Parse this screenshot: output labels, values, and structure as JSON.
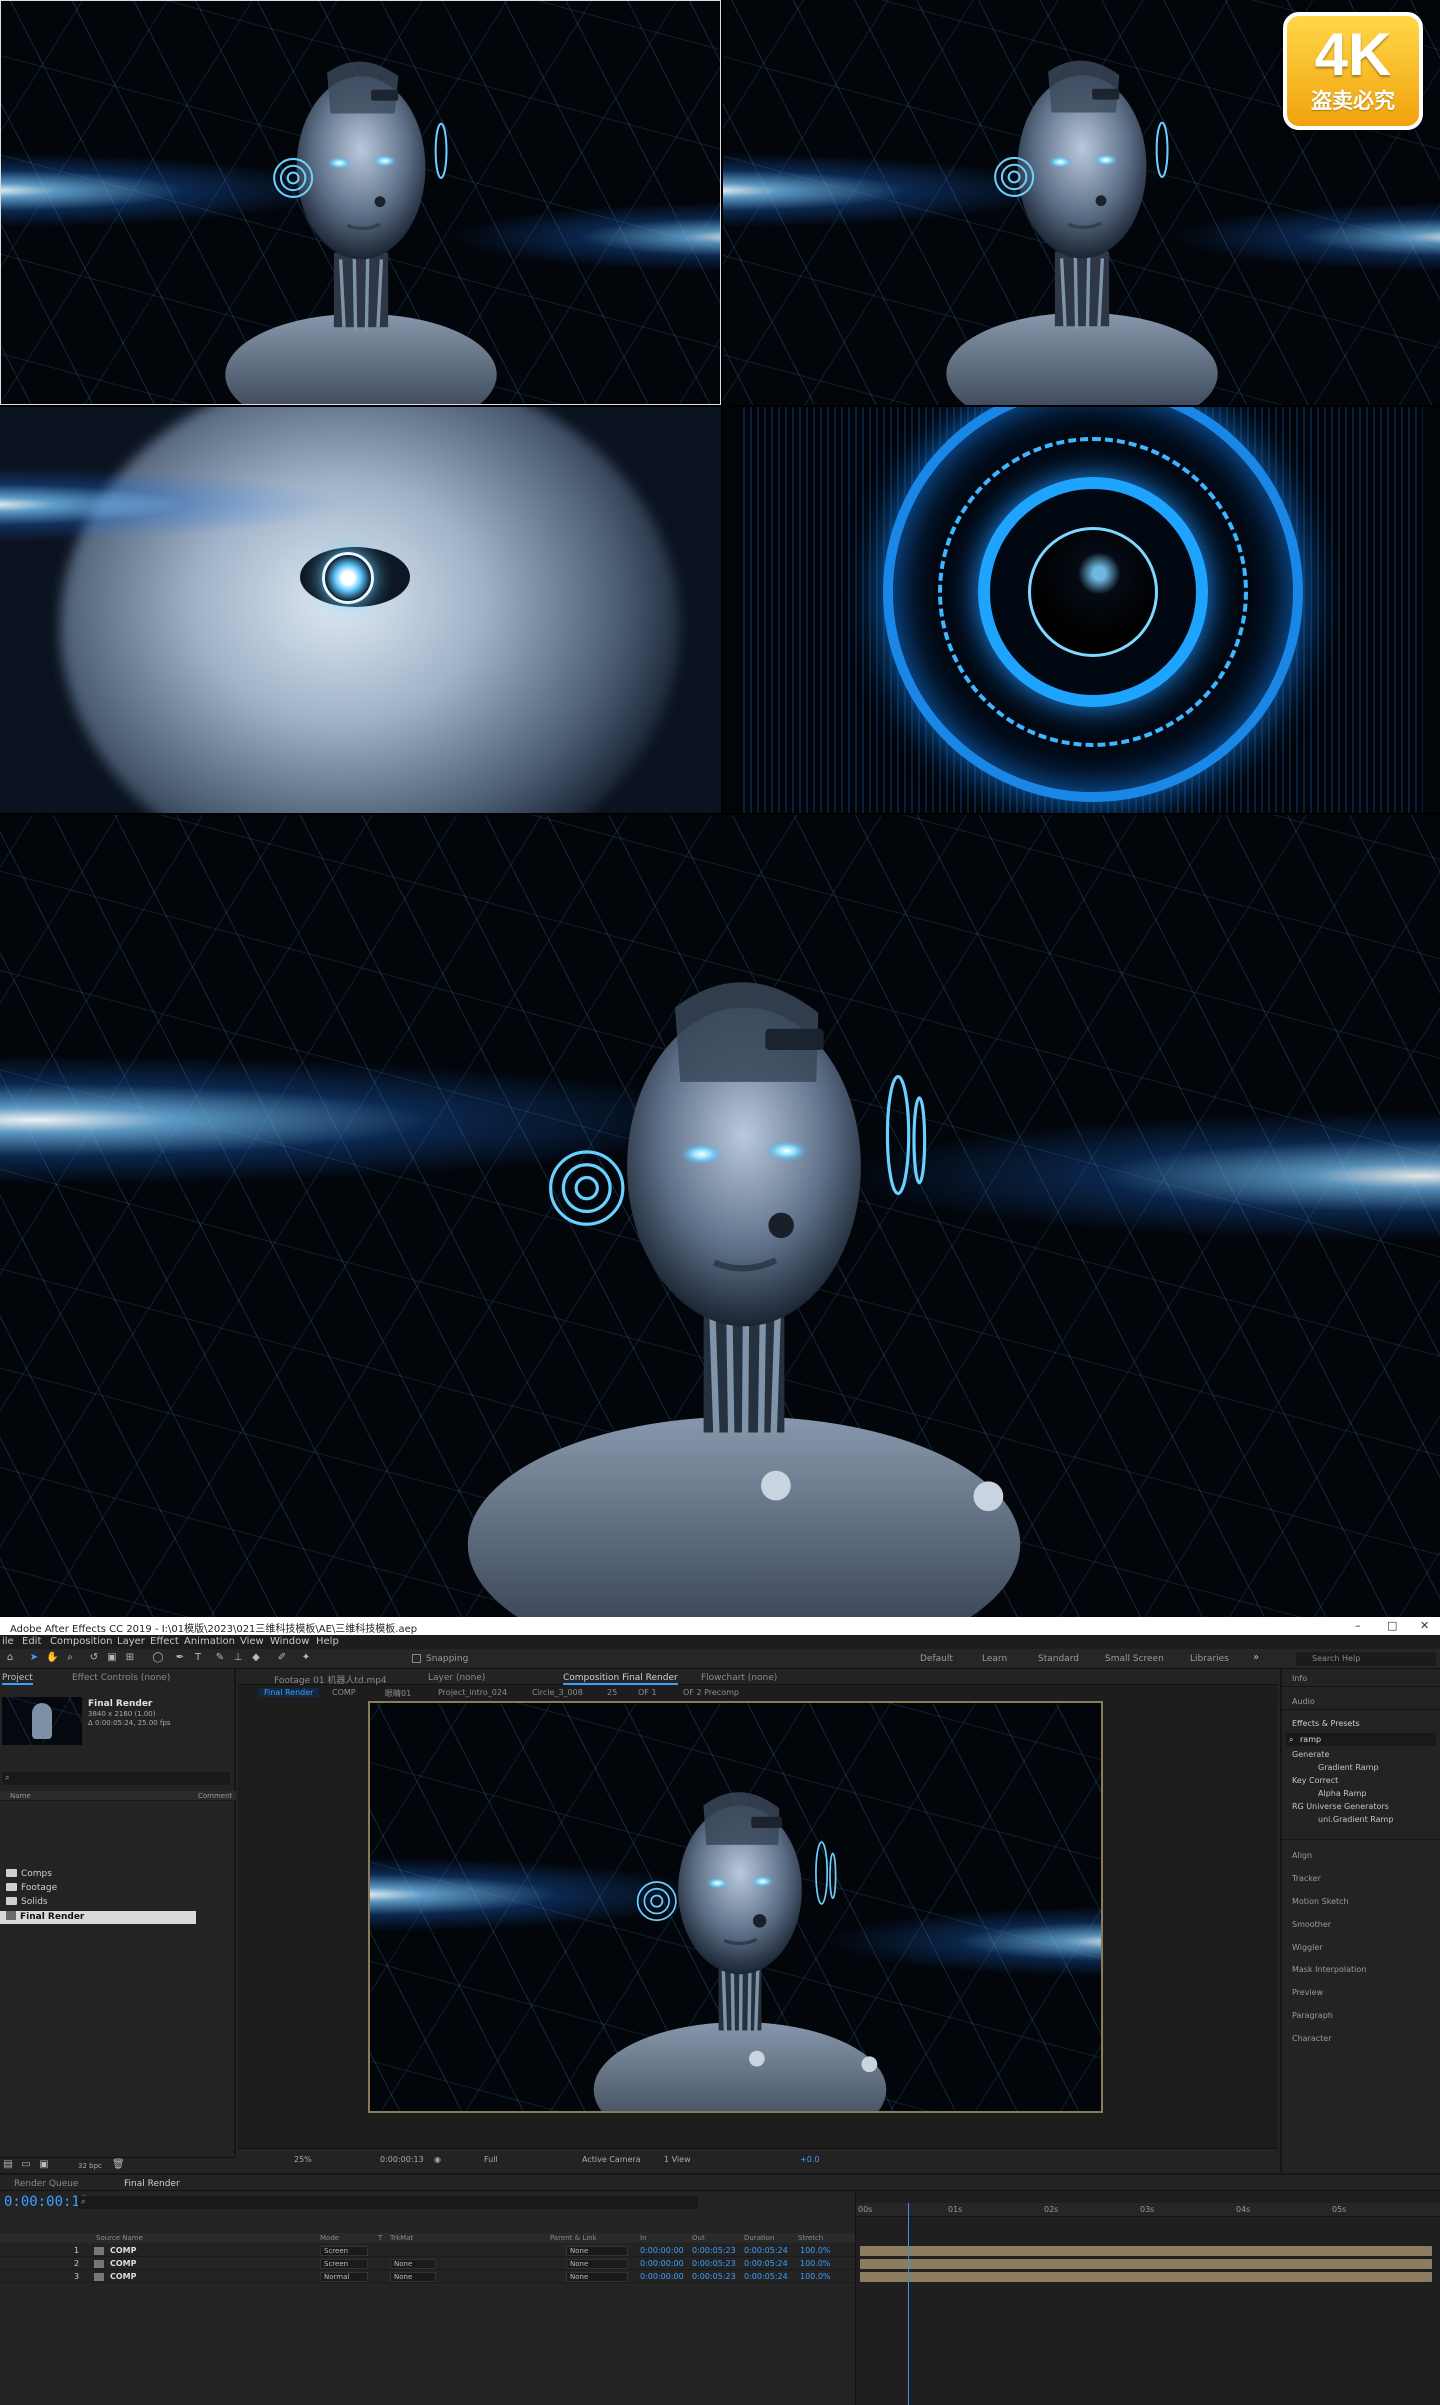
{
  "badge": {
    "big": "4K",
    "small": "盗卖必究"
  },
  "window": {
    "title": "Adobe After Effects CC 2019 - I:\\01模版\\2023\\021三维科技模板\\AE\\三维科技模板.aep",
    "controls": [
      "–",
      "□",
      "✕"
    ]
  },
  "menu": [
    "ile",
    "Edit",
    "Composition",
    "Layer",
    "Effect",
    "Animation",
    "View",
    "Window",
    "Help"
  ],
  "toolbar": {
    "snapping": "Snapping",
    "workspaces": [
      "Default",
      "Learn",
      "Standard",
      "Small Screen",
      "Libraries"
    ],
    "search_help": "Search Help"
  },
  "project": {
    "tab_project": "Project",
    "tab_effect_controls": "Effect Controls (none)",
    "selected_name": "Final Render",
    "selected_size": "3840 x 2160 (1.00)",
    "selected_duration": "Δ 0:00:05:24, 25.00 fps",
    "col_name": "Name",
    "col_comment": "Comment",
    "items": [
      "Comps",
      "Footage",
      "Solids",
      "Final Render"
    ],
    "bpc": "32 bpc"
  },
  "viewer": {
    "tabs": [
      "Footage 01 机器人td.mp4",
      "Layer (none)",
      "Composition Final Render",
      "Flowchart (none)"
    ],
    "crumbs": [
      "Final Render",
      "COMP",
      "眼睛01",
      "Project_intro_024",
      "Circle_3_008",
      "25",
      "OF 1",
      "OF 2 Precomp"
    ],
    "zoom": "25%",
    "time": "0:00:00:13",
    "quality": "Full",
    "camera": "Active Camera",
    "views": "1 View",
    "exposure": "+0.0"
  },
  "right": {
    "info": "Info",
    "audio": "Audio",
    "effects_presets": "Effects & Presets",
    "search_value": "ramp",
    "tree": [
      "Generate",
      "Gradient Ramp",
      "Key Correct",
      "Alpha Ramp",
      "RG Universe Generators",
      "uni.Gradient Ramp"
    ],
    "panels": [
      "Align",
      "Tracker",
      "Motion Sketch",
      "Smoother",
      "Wiggler",
      "Mask Interpolation",
      "Preview",
      "Paragraph",
      "Character"
    ]
  },
  "timeline": {
    "tabs": [
      "Render Queue",
      "Final Render"
    ],
    "timecode": "0:00:00:13",
    "columns": [
      "Source Name",
      "Mode",
      "T",
      "TrkMat",
      "Parent & Link",
      "In",
      "Out",
      "Duration",
      "Stretch"
    ],
    "layers": [
      {
        "num": "1",
        "name": "COMP",
        "mode": "Screen",
        "trkmat": "",
        "parent": "None",
        "in": "0:00:00:00",
        "out": "0:00:05:23",
        "duration": "0:00:05:24",
        "stretch": "100.0%"
      },
      {
        "num": "2",
        "name": "COMP",
        "mode": "Screen",
        "trkmat": "None",
        "parent": "None",
        "in": "0:00:00:00",
        "out": "0:00:05:23",
        "duration": "0:00:05:24",
        "stretch": "100.0%"
      },
      {
        "num": "3",
        "name": "COMP",
        "mode": "Normal",
        "trkmat": "None",
        "parent": "None",
        "in": "0:00:00:00",
        "out": "0:00:05:23",
        "duration": "0:00:05:24",
        "stretch": "100.0%"
      }
    ],
    "ruler": [
      "00s",
      "01s",
      "02s",
      "03s",
      "04s",
      "05s"
    ]
  },
  "colors": {
    "accent": "#3aa0ff",
    "layer_bar": "#8c7c60",
    "badge": "#f6b820"
  }
}
